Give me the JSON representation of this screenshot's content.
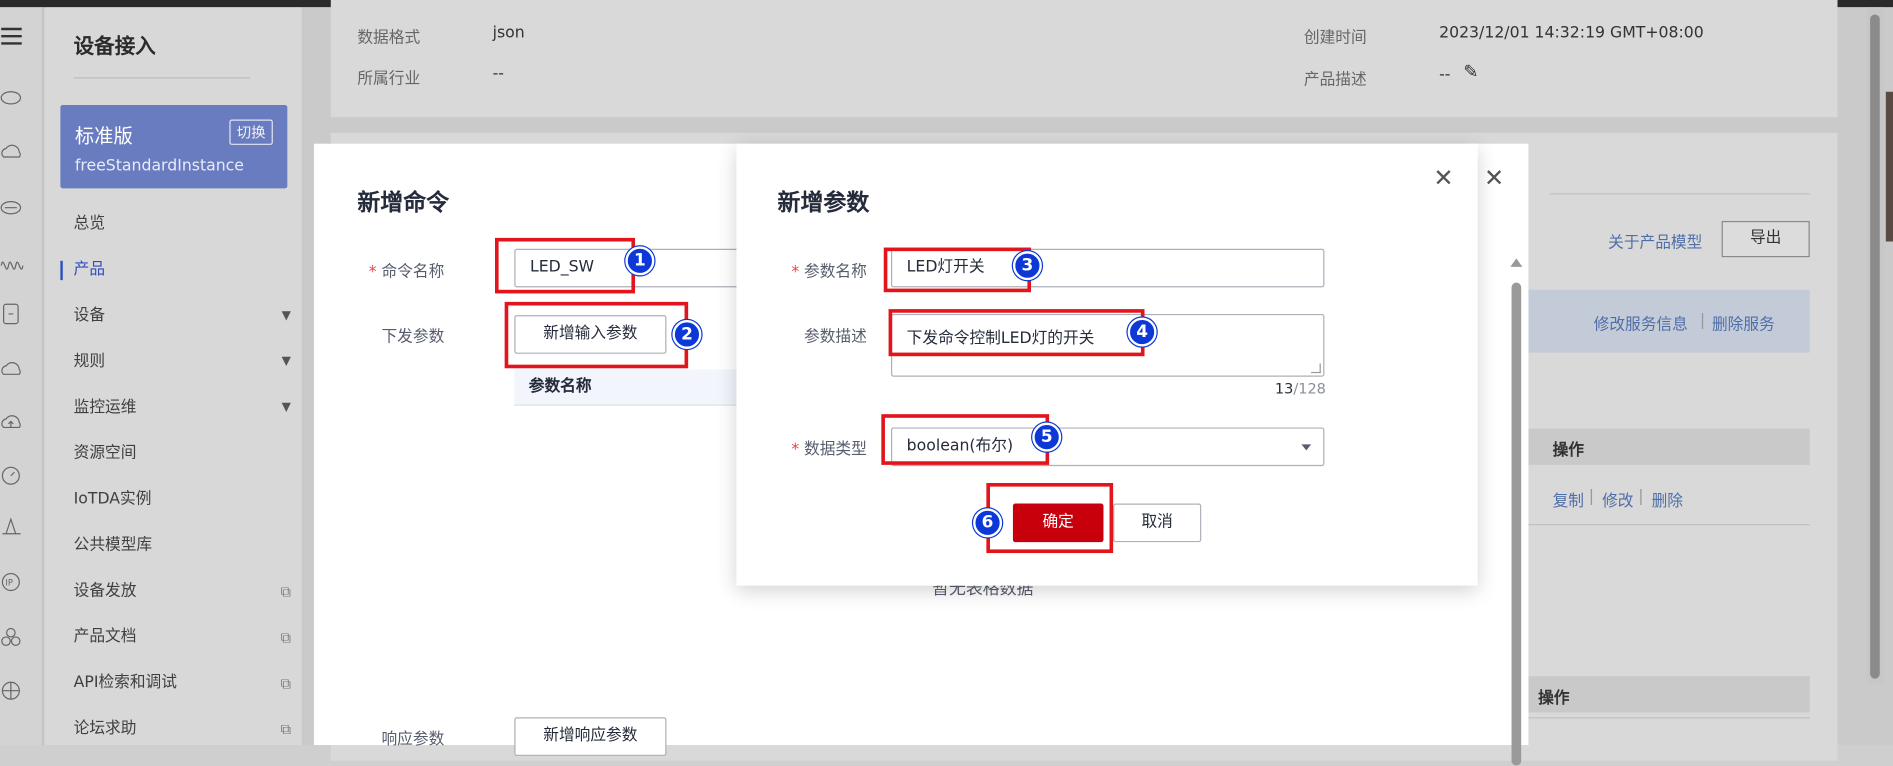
{
  "sidebar": {
    "title": "设备接入",
    "edition": {
      "name": "标准版",
      "switch_label": "切换",
      "instance": "freeStandardInstance"
    },
    "items": [
      {
        "label": "总览"
      },
      {
        "label": "产品"
      },
      {
        "label": "设备"
      },
      {
        "label": "规则"
      },
      {
        "label": "监控运维"
      },
      {
        "label": "资源空间"
      },
      {
        "label": "IoTDA实例"
      },
      {
        "label": "公共模型库"
      },
      {
        "label": "设备发放"
      },
      {
        "label": "产品文档"
      },
      {
        "label": "API检索和调试"
      },
      {
        "label": "论坛求助"
      }
    ]
  },
  "product_info": {
    "data_format_label": "数据格式",
    "data_format_value": "json",
    "industry_label": "所属行业",
    "industry_value": "--",
    "created_label": "创建时间",
    "created_value": "2023/12/01 14:32:19 GMT+08:00",
    "desc_label": "产品描述",
    "desc_value": "--"
  },
  "background": {
    "about_model_link": "关于产品模型",
    "export_button": "导出",
    "edit_service_link": "修改服务信息",
    "delete_service_link": "删除服务",
    "ops_header": "操作",
    "copy_link": "复制",
    "modify_link": "修改",
    "delete_link": "删除",
    "ops_header_2": "操作"
  },
  "add_command_dialog": {
    "title": "新增命令",
    "name_label": "命令名称",
    "name_value": "LED_SW",
    "down_params_label": "下发参数",
    "add_input_param_button": "新增输入参数",
    "param_name_header": "参数名称",
    "empty_text": "暂无表格数据",
    "response_params_label": "响应参数",
    "add_response_param_button": "新增响应参数"
  },
  "add_param_dialog": {
    "title": "新增参数",
    "name_label": "参数名称",
    "name_value": "LED灯开关",
    "desc_label": "参数描述",
    "desc_value": "下发命令控制LED灯的开关",
    "counter_current": "13",
    "counter_max": "/128",
    "type_label": "数据类型",
    "type_value": "boolean(布尔)",
    "confirm_button": "确定",
    "cancel_button": "取消"
  },
  "annotations": {
    "badges": [
      "1",
      "2",
      "3",
      "4",
      "5",
      "6"
    ],
    "color": "#e3151c",
    "badge_color": "#0b38d6"
  },
  "colors": {
    "primary": "#c7000b",
    "accent": "#2e4dbe",
    "required": "#e54545"
  }
}
